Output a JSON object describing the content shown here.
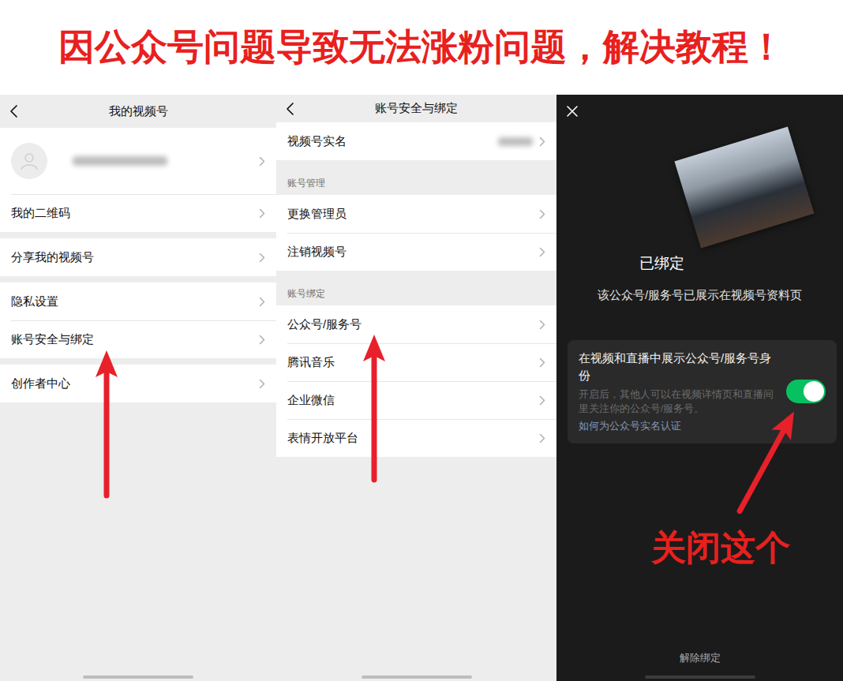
{
  "banner": {
    "title": "因公众号问题导致无法涨粉问题，解决教程！"
  },
  "list_panels": [
    {
      "title": "我的视频号",
      "sections": [
        {
          "rows": [
            {
              "kind": "profile",
              "arrow": false
            },
            {
              "kind": "link",
              "label": "我的二维码",
              "arrow": false
            }
          ]
        },
        {
          "rows": [
            {
              "kind": "link",
              "label": "分享我的视频号",
              "arrow": false
            }
          ]
        },
        {
          "rows": [
            {
              "kind": "link",
              "label": "隐私设置",
              "arrow": false
            },
            {
              "kind": "link",
              "label": "账号安全与绑定",
              "arrow": true
            }
          ]
        },
        {
          "rows": [
            {
              "kind": "link",
              "label": "创作者中心",
              "arrow": false
            }
          ]
        }
      ]
    },
    {
      "title": "账号安全与绑定",
      "sections": [
        {
          "rows": [
            {
              "kind": "link-value",
              "label": "视频号实名",
              "arrow": false
            }
          ]
        },
        {
          "header": "账号管理",
          "rows": [
            {
              "kind": "link",
              "label": "更换管理员",
              "arrow": false
            },
            {
              "kind": "link",
              "label": "注销视频号",
              "arrow": false
            }
          ]
        },
        {
          "header": "账号绑定",
          "rows": [
            {
              "kind": "link",
              "label": "公众号/服务号",
              "arrow": true
            },
            {
              "kind": "link",
              "label": "腾讯音乐",
              "arrow": false
            },
            {
              "kind": "link",
              "label": "企业微信",
              "arrow": false
            },
            {
              "kind": "link",
              "label": "表情开放平台",
              "arrow": false
            }
          ]
        }
      ]
    }
  ],
  "detail_panel": {
    "status": "已绑定",
    "subtitle": "该公众号/服务号已展示在视频号资料页",
    "setting": {
      "label": "在视频和直播中展示公众号/服务号身份",
      "description": "开启后，其他人可以在视频详情页和直播间里关注你的公众号/服务号。",
      "link": "如何为公众号实名认证",
      "on": true
    },
    "annotation": "关闭这个",
    "footer": "解除绑定"
  }
}
